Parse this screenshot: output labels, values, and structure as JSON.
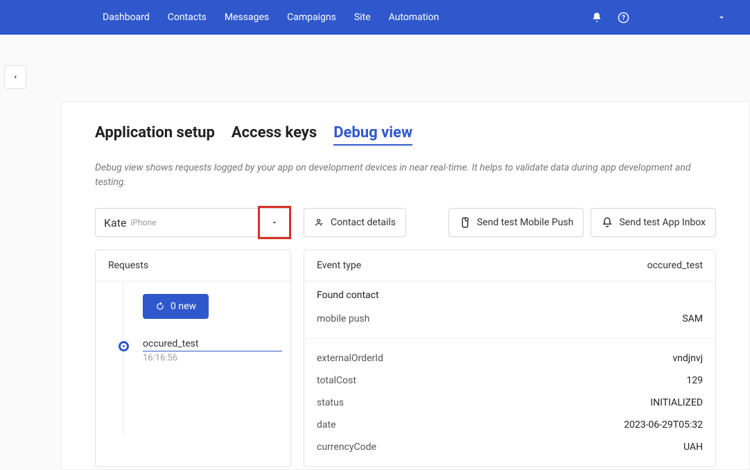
{
  "nav": {
    "items": [
      "Dashboard",
      "Contacts",
      "Messages",
      "Campaigns",
      "Site",
      "Automation"
    ]
  },
  "tabs": {
    "setup": "Application setup",
    "keys": "Access keys",
    "debug": "Debug view"
  },
  "description": "Debug view shows requests logged by your app on development devices in near real-time. It helps to validate data during app development and testing.",
  "device": {
    "name": "Kate",
    "sub": "iPhone"
  },
  "buttons": {
    "contact_details": "Contact details",
    "send_push": "Send test Mobile Push",
    "send_inbox": "Send test App Inbox"
  },
  "requests": {
    "header": "Requests",
    "new_count_label": "0 new",
    "items": [
      {
        "title": "occured_test",
        "time": "16:16:56"
      }
    ]
  },
  "details": {
    "event_type_label": "Event type",
    "event_type_value": "occured_test",
    "found_contact_label": "Found contact",
    "found": [
      {
        "k": "mobile push",
        "v": "SAM"
      }
    ],
    "params": [
      {
        "k": "externalOrderId",
        "v": "vndjnvj"
      },
      {
        "k": "totalCost",
        "v": "129"
      },
      {
        "k": "status",
        "v": "INITIALIZED"
      },
      {
        "k": "date",
        "v": "2023-06-29T05:32"
      },
      {
        "k": "currencyCode",
        "v": "UAH"
      }
    ]
  }
}
